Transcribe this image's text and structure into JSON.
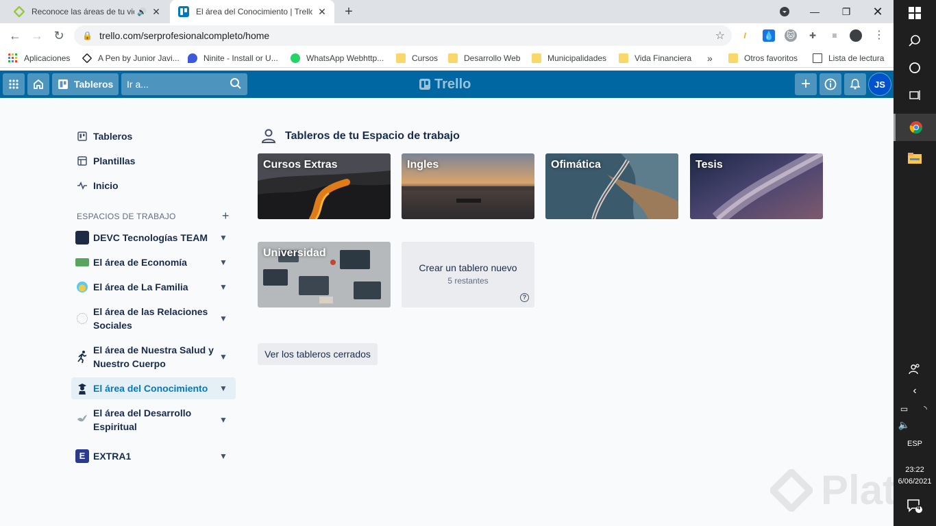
{
  "browser": {
    "tabs": [
      {
        "title": "Reconoce las áreas de tu vida",
        "state": "inactive"
      },
      {
        "title": "El área del Conocimiento | Trello",
        "state": "active"
      }
    ],
    "url": "trello.com/serprofesionalcompleto/home",
    "bookmarks": [
      {
        "label": "Aplicaciones",
        "icon": "apps-grid-icon"
      },
      {
        "label": "A Pen by Junior Javi...",
        "icon": "codepen-icon"
      },
      {
        "label": "Ninite - Install or U...",
        "icon": "ninite-icon"
      },
      {
        "label": "WhatsApp Webhttp...",
        "icon": "whatsapp-icon"
      },
      {
        "label": "Cursos",
        "icon": "folder-icon"
      },
      {
        "label": "Desarrollo Web",
        "icon": "folder-icon"
      },
      {
        "label": "Municipalidades",
        "icon": "folder-icon"
      },
      {
        "label": "Vida Financiera",
        "icon": "folder-icon"
      }
    ],
    "bookmarks_overflow": "»",
    "other_bookmarks": "Otros favoritos",
    "reading_list": "Lista de lectura"
  },
  "trello": {
    "header": {
      "boards_button": "Tableros",
      "search_placeholder": "Ir a...",
      "logo": "Trello",
      "avatar_initials": "JS"
    },
    "sidebar": {
      "nav": [
        {
          "label": "Tableros",
          "icon": "board-icon"
        },
        {
          "label": "Plantillas",
          "icon": "template-icon"
        },
        {
          "label": "Inicio",
          "icon": "pulse-icon"
        }
      ],
      "workspaces_title": "ESPACIOS DE TRABAJO",
      "workspaces": [
        {
          "line1": "DEVC Tecnologías TEAM",
          "line2": ""
        },
        {
          "line1": "El área de Economía",
          "line2": ""
        },
        {
          "line1": "El área de La Familia",
          "line2": ""
        },
        {
          "line1": "El área de las Relaciones",
          "line2": "Sociales"
        },
        {
          "line1": "El área de Nuestra Salud y",
          "line2": "Nuestro Cuerpo"
        },
        {
          "line1": "El área del Conocimiento",
          "line2": ""
        },
        {
          "line1": "El área del Desarrollo",
          "line2": "Espiritual"
        },
        {
          "line1": "EXTRA1",
          "line2": "",
          "initial": "E"
        }
      ]
    },
    "main": {
      "section_title": "Tableros de tu Espacio de trabajo",
      "boards": [
        "Cursos Extras",
        "Ingles",
        "Ofimática",
        "Tesis",
        "Universidad"
      ],
      "new_board": {
        "label": "Crear un tablero nuevo",
        "remaining": "5 restantes"
      },
      "closed_boards_button": "Ver los tableros cerrados"
    },
    "watermark": "Platzi"
  },
  "taskbar": {
    "language": "ESP",
    "time": "23:22",
    "date": "6/06/2021",
    "notifications": "4"
  },
  "colors": {
    "trello_header": "#0067a3",
    "active_workspace_bg": "#e4f0f6",
    "active_workspace_text": "#0079bf",
    "avatar": "#0052cc"
  }
}
